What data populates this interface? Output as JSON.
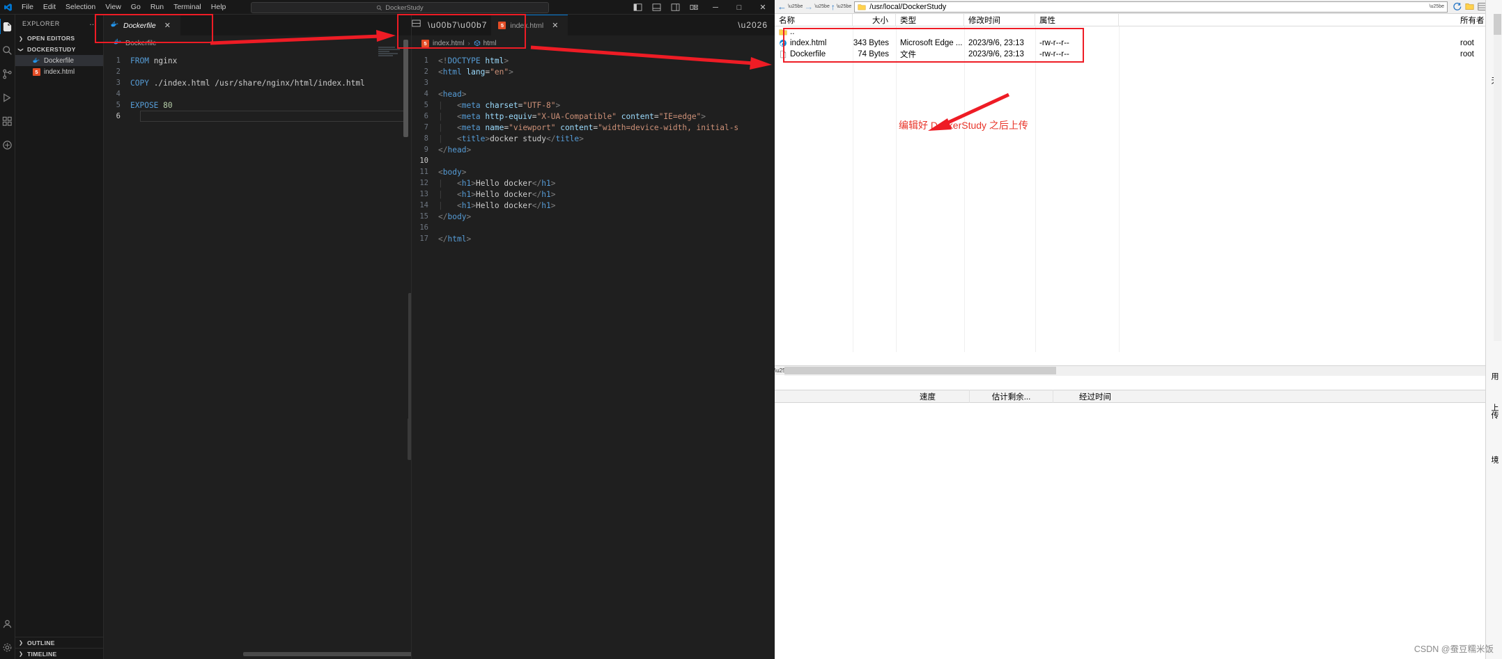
{
  "vscode": {
    "menu": [
      "File",
      "Edit",
      "Selection",
      "View",
      "Go",
      "Run",
      "Terminal",
      "Help"
    ],
    "search_value": "DockerStudy",
    "search_icon": "search-icon",
    "nav_back": "←",
    "nav_forward": "→",
    "window_controls": {
      "minimize": "─",
      "maximize": "□",
      "close": "✕"
    },
    "activity_items": [
      "explorer-icon",
      "search-icon",
      "source-control-icon",
      "run-debug-icon",
      "extensions-icon",
      "docker-icon"
    ],
    "activity_bottom": [
      "account-icon",
      "settings-gear-icon"
    ],
    "sidebar": {
      "title": "EXPLORER",
      "more": "…",
      "sections": [
        {
          "label": "OPEN EDITORS",
          "chevron": "❯",
          "expanded": false
        },
        {
          "label": "DOCKERSTUDY",
          "chevron": "❯",
          "expanded": true
        }
      ],
      "files": [
        {
          "name": "Dockerfile",
          "icon": "docker-file-icon",
          "selected": true
        },
        {
          "name": "index.html",
          "icon": "html5-file-icon",
          "selected": false
        }
      ],
      "footers": [
        {
          "label": "OUTLINE",
          "chevron": "❯"
        },
        {
          "label": "TIMELINE",
          "chevron": "❯"
        }
      ]
    },
    "editor_left": {
      "tab": {
        "label": "Dockerfile",
        "icon": "docker-file-icon",
        "close": "✕"
      },
      "breadcrumb": {
        "file": "Dockerfile",
        "icon": "docker-file-icon"
      },
      "lines": [
        {
          "n": "1",
          "text": "FROM nginx"
        },
        {
          "n": "2",
          "text": ""
        },
        {
          "n": "3",
          "text": "COPY ./index.html /usr/share/nginx/html/index.html"
        },
        {
          "n": "4",
          "text": ""
        },
        {
          "n": "5",
          "text": "EXPOSE 80"
        },
        {
          "n": "6",
          "text": ""
        }
      ]
    },
    "editor_right": {
      "split_icon": "split-editor-icon",
      "more_icon": "more-actions-icon",
      "tab": {
        "label": "index.html",
        "icon": "html5-file-icon",
        "close": "✕"
      },
      "breadcrumb": {
        "file": "index.html",
        "separator": "›",
        "symbol": "html",
        "symbol_icon": "symbol-field-icon"
      },
      "lines": [
        {
          "n": "1",
          "text": "<!DOCTYPE html>"
        },
        {
          "n": "2",
          "text": "<html lang=\"en\">"
        },
        {
          "n": "3",
          "text": ""
        },
        {
          "n": "4",
          "text": "<head>"
        },
        {
          "n": "5",
          "text": "    <meta charset=\"UTF-8\">"
        },
        {
          "n": "6",
          "text": "    <meta http-equiv=\"X-UA-Compatible\" content=\"IE=edge\">"
        },
        {
          "n": "7",
          "text": "    <meta name=\"viewport\" content=\"width=device-width, initial-s"
        },
        {
          "n": "8",
          "text": "    <title>docker study</title>"
        },
        {
          "n": "9",
          "text": "</head>"
        },
        {
          "n": "10",
          "text": ""
        },
        {
          "n": "11",
          "text": "<body>"
        },
        {
          "n": "12",
          "text": "    <h1>Hello docker</h1>"
        },
        {
          "n": "13",
          "text": "    <h1>Hello docker</h1>"
        },
        {
          "n": "14",
          "text": "    <h1>Hello docker</h1>"
        },
        {
          "n": "15",
          "text": "</body>"
        },
        {
          "n": "16",
          "text": ""
        },
        {
          "n": "17",
          "text": "</html>"
        }
      ]
    }
  },
  "file_manager": {
    "path": "/usr/local/DockerStudy",
    "back_arrow": "←",
    "forward_arrow": "→",
    "up_arrow": "↑",
    "columns": [
      "名称",
      "大小",
      "类型",
      "修改时间",
      "属性",
      "所有者"
    ],
    "rows": [
      {
        "name": "..",
        "icon": "folder-icon",
        "size": "",
        "type": "",
        "time": "",
        "attr": "",
        "owner": ""
      },
      {
        "name": "index.html",
        "icon": "edge-browser-icon",
        "size": "343 Bytes",
        "type": "Microsoft Edge ...",
        "time": "2023/9/6, 23:13",
        "attr": "-rw-r--r--",
        "owner": "root"
      },
      {
        "name": "Dockerfile",
        "icon": "generic-file-icon",
        "size": "74 Bytes",
        "type": "文件",
        "time": "2023/9/6, 23:13",
        "attr": "-rw-r--r--",
        "owner": "root"
      }
    ],
    "annotation": "编辑好 DockerStudy 之后上传",
    "status_columns": [
      "速度",
      "估计剩余...",
      "经过时间"
    ],
    "rail_labels": [
      "无",
      "用",
      "上传",
      "境"
    ]
  },
  "watermark": "CSDN @蚕豆糯米饭",
  "colors": {
    "accent": "#0078d4",
    "annotation_red": "#ee1c25",
    "vscode_bg": "#1f1f1f",
    "sidebar_bg": "#181818"
  }
}
